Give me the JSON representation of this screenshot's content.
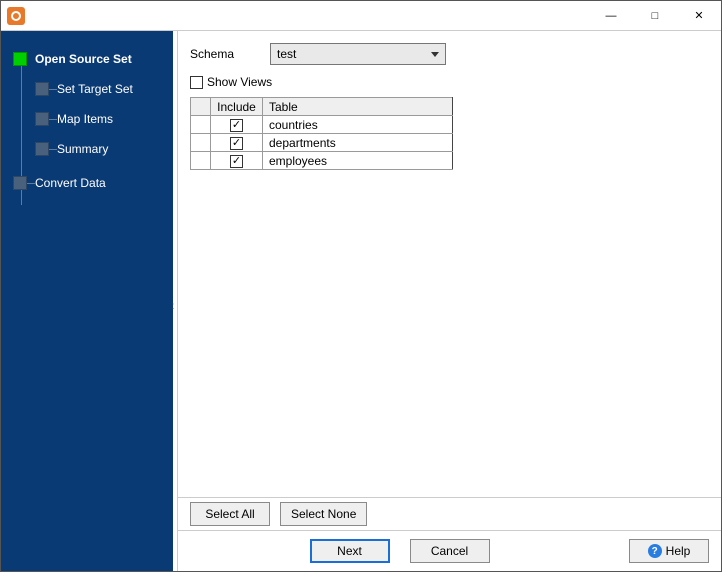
{
  "titlebar": {
    "minimize_glyph": "—",
    "maximize_glyph": "□",
    "close_glyph": "✕"
  },
  "sidebar": {
    "items": [
      {
        "label": "Open Source Set",
        "kind": "root"
      },
      {
        "label": "Set Target Set",
        "kind": "sub"
      },
      {
        "label": "Map Items",
        "kind": "sub"
      },
      {
        "label": "Summary",
        "kind": "sub"
      },
      {
        "label": "Convert Data",
        "kind": "top2"
      }
    ]
  },
  "form": {
    "schema_label": "Schema",
    "schema_value": "test",
    "show_views_label": "Show Views",
    "show_views_checked": false
  },
  "table": {
    "headers": {
      "include": "Include",
      "table": "Table"
    },
    "rows": [
      {
        "include": true,
        "table": "countries"
      },
      {
        "include": true,
        "table": "departments"
      },
      {
        "include": true,
        "table": "employees"
      }
    ]
  },
  "buttons": {
    "select_all": "Select All",
    "select_none": "Select None",
    "next": "Next",
    "cancel": "Cancel",
    "help": "Help"
  }
}
